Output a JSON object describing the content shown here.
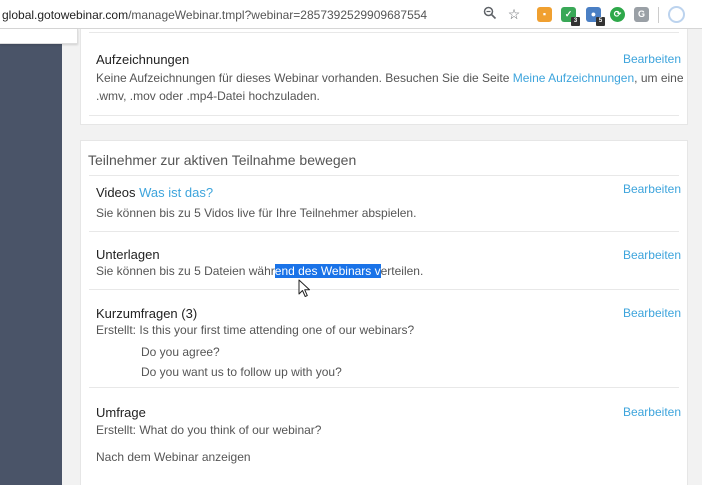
{
  "browser": {
    "url_host": "global.gotowebinar.com",
    "url_path": "/manageWebinar.tmpl?webinar=2857392529909687554",
    "icons": [
      "zoom-icon",
      "star-icon"
    ],
    "extensions": [
      {
        "name": "orange-extension-icon",
        "color": "#f0a030",
        "glyph": "G"
      },
      {
        "name": "green-check-extension-icon",
        "color": "#39a857",
        "glyph": "✓",
        "badge": "3"
      },
      {
        "name": "blue-extension-icon",
        "color": "#4a7fc4",
        "glyph": "",
        "badge": "5"
      },
      {
        "name": "green-circle-extension-icon",
        "color": "#2ea84a",
        "glyph": "⟳"
      },
      {
        "name": "gray-g-extension-icon",
        "color": "#9aa0a6",
        "glyph": "G"
      }
    ]
  },
  "recordings": {
    "title": "Aufzeichnungen",
    "edit_label": "Bearbeiten",
    "text_before": "Keine Aufzeichnungen für dieses Webinar vorhanden. Besuchen Sie die Seite ",
    "link": "Meine Aufzeichnungen",
    "text_after_line1": ", um eine",
    "text_line2": ".wmv, .mov oder .mp4-Datei hochzuladen."
  },
  "engage": {
    "heading": "Teilnehmer zur aktiven Teilnahme bewegen",
    "videos": {
      "title": "Videos",
      "help_link": "Was ist das?",
      "edit_label": "Bearbeiten",
      "text": "Sie können bis zu 5 Vidos live für Ihre Teilnehmer abspielen."
    },
    "handouts": {
      "title": "Unterlagen",
      "edit_label": "Bearbeiten",
      "text_before": "Sie können bis zu 5 Dateien währ",
      "text_selected": "end des Webinars v",
      "text_after": "erteilen."
    },
    "polls": {
      "title": "Kurzumfragen (3)",
      "edit_label": "Bearbeiten",
      "created_label": "Erstellt:",
      "items": [
        "Is this your first time attending one of our webinars?",
        "Do you agree?",
        "Do you want us to follow up with you?"
      ]
    },
    "survey": {
      "title": "Umfrage",
      "edit_label": "Bearbeiten",
      "created_label": "Erstellt:",
      "item": "What do you think of our webinar?",
      "timing": "Nach dem Webinar anzeigen"
    }
  }
}
